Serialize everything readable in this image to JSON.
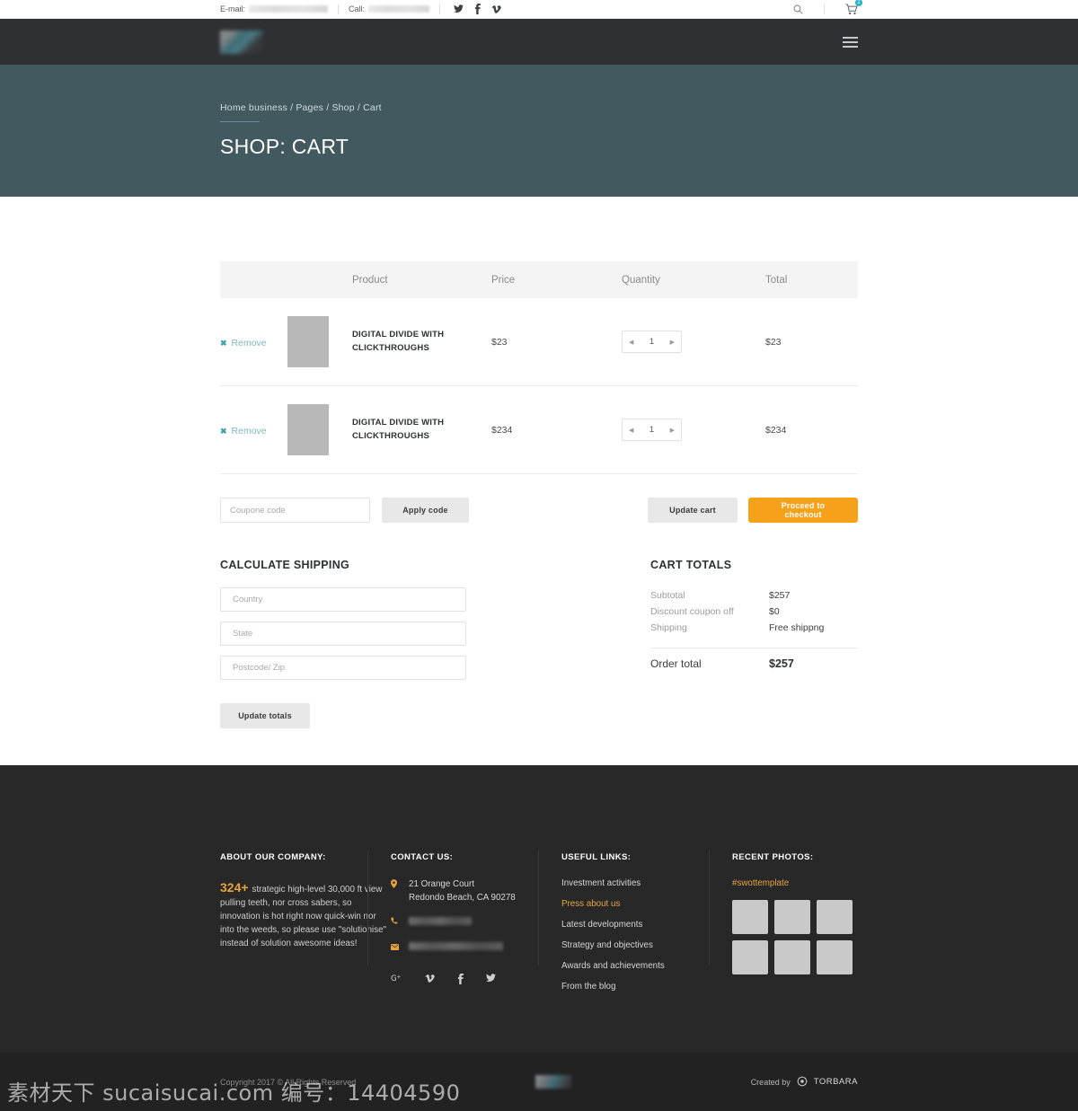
{
  "topbar": {
    "email_label": "E-mail:",
    "email_value_redacted": true,
    "call_label": "Call:",
    "call_value_redacted": true,
    "social": [
      "twitter-icon",
      "facebook-icon",
      "vimeo-icon"
    ],
    "search_icon": "search-icon",
    "cart_icon": "cart-icon",
    "cart_count": "2"
  },
  "header": {
    "logo": "site-logo-redacted",
    "menu_icon": "hamburger-menu-icon"
  },
  "hero": {
    "breadcrumb": "Home business / Pages / Shop / Cart",
    "title": "SHOP: CART"
  },
  "cart": {
    "columns": [
      "",
      "",
      "Product",
      "Price",
      "Quantity",
      "Total"
    ],
    "headers": {
      "product": "Product",
      "price": "Price",
      "quantity": "Quantity",
      "total": "Total"
    },
    "items": [
      {
        "remove_label": "Remove",
        "name": "DIGITAL DIVIDE WITH CLICKTHROUGHS",
        "price": "$23",
        "quantity": "1",
        "total": "$23"
      },
      {
        "remove_label": "Remove",
        "name": "DIGITAL DIVIDE WITH CLICKTHROUGHS",
        "price": "$234",
        "quantity": "1",
        "total": "$234"
      }
    ]
  },
  "actions": {
    "coupon_placeholder": "Coupone code",
    "coupon_value": "",
    "apply_label": "Apply code",
    "update_cart_label": "Update cart",
    "checkout_label": "Proceed to checkout"
  },
  "shipping": {
    "title": "CALCULATE SHIPPING",
    "country_placeholder": "Country",
    "state_placeholder": "State",
    "postcode_placeholder": "Postcode/ Zip",
    "update_totals_label": "Update totals"
  },
  "totals": {
    "title": "CART TOTALS",
    "rows": [
      {
        "label": "Subtotal",
        "value": "$257"
      },
      {
        "label": "Discount coupon off",
        "value": "$0"
      },
      {
        "label": "Shipping",
        "value": "Free shippng"
      }
    ],
    "order_total_label": "Order total",
    "order_total_value": "$257"
  },
  "footer": {
    "about": {
      "title": "ABOUT OUR COMPANY:",
      "number": "324+",
      "text": "strategic high-level 30,000 ft view pulling teeth, nor cross sabers, so innovation is hot right now quick-win nor into the weeds, so please use \"solutionise\" instead of solution awesome ideas!"
    },
    "contact": {
      "title": "CONTACT US:",
      "address_line1": "21 Orange Court",
      "address_line2": "Redondo Beach, CA 90278",
      "phone_redacted": true,
      "email_redacted": true,
      "social": [
        "google-plus-icon",
        "vimeo-icon",
        "facebook-icon",
        "twitter-icon"
      ]
    },
    "links": {
      "title": "USEFUL LINKS:",
      "items": [
        {
          "label": "Investment activities",
          "active": false
        },
        {
          "label": "Press about us",
          "active": true
        },
        {
          "label": "Latest developments",
          "active": false
        },
        {
          "label": "Strategy and objectives",
          "active": false
        },
        {
          "label": "Awards and achievements",
          "active": false
        },
        {
          "label": "From the blog",
          "active": false
        }
      ]
    },
    "photos": {
      "title": "RECENT PHOTOS:",
      "tag": "#swottemplate",
      "count": 6
    }
  },
  "copyright": {
    "text": "Copyright 2017  ©  All Rights Reserved",
    "created_by_label": "Created by",
    "brand": "TORBARA"
  },
  "watermark": {
    "text": "素材天下 sucaisucai.com 编号：14404590"
  },
  "colors": {
    "hero_bg": "#41595f",
    "header_bg": "#2e3033",
    "accent_orange": "#f5a11a",
    "accent_teal": "#7fb8c4",
    "footer_bg": "#282828",
    "footer_accent": "#e8a33d"
  }
}
